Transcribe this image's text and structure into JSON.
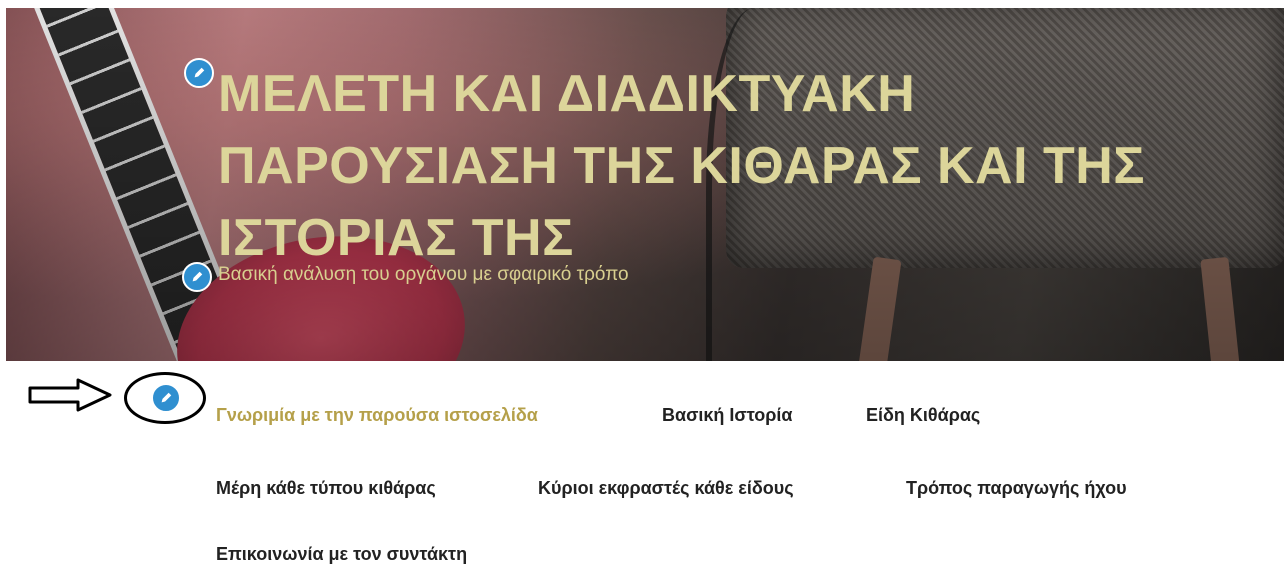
{
  "header": {
    "title": "ΜΕΛΕΤΗ ΚΑΙ ΔΙΑΔΙΚΤΥΑΚΗ ΠΑΡΟΥΣΙΑΣΗ ΤΗΣ ΚΙΘΑΡΑΣ ΚΑΙ ΤΗΣ ΙΣΤΟΡΙΑΣ ΤΗΣ",
    "tagline": "Βασική ανάλυση του οργάνου με σφαιρικό τρόπο"
  },
  "nav": {
    "items": [
      {
        "label": "Γνωριμία με την παρούσα ιστοσελίδα",
        "active": true
      },
      {
        "label": "Βασική Ιστορία"
      },
      {
        "label": "Είδη Κιθάρας"
      },
      {
        "label": "Μέρη κάθε τύπου κιθάρας"
      },
      {
        "label": "Κύριοι εκφραστές κάθε είδους"
      },
      {
        "label": "Τρόπος παραγωγής ήχου"
      },
      {
        "label": "Επικοινωνία με τον συντάκτη"
      }
    ]
  },
  "colors": {
    "title": "#dcd59a",
    "active_link": "#b5a04a",
    "edit_icon": "#2f8fd0"
  },
  "icons": [
    "pencil-icon",
    "right-arrow-icon"
  ]
}
